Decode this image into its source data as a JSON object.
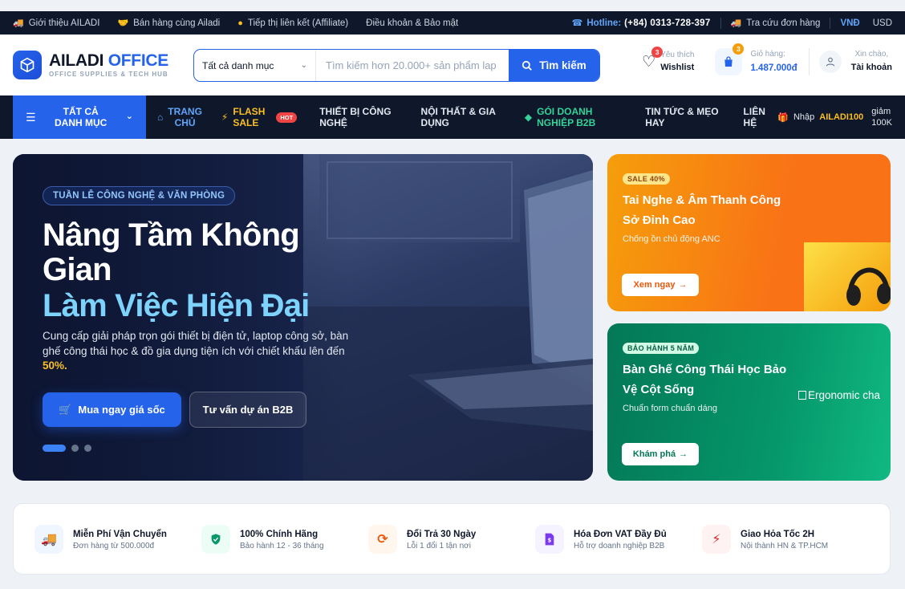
{
  "utility": {
    "links": [
      {
        "icon": "truck-icon",
        "label": "Giới thiệu AILADI",
        "color": "#60a5fa"
      },
      {
        "icon": "handshake-icon",
        "label": "Bán hàng cùng Ailadi",
        "color": "#34d399"
      },
      {
        "icon": "coins-icon",
        "label": "Tiếp thị liên kết (Affiliate)",
        "color": "#fbbf24"
      },
      {
        "icon": "",
        "label": "Điều khoản & Bảo mật",
        "color": ""
      }
    ],
    "hotline_label": "Hotline:",
    "hotline_number": "(+84) 0313-728-397",
    "order_lookup": "Tra cứu đơn hàng",
    "currencies": [
      "VNĐ",
      "USD"
    ]
  },
  "header": {
    "logo_main_a": "AILADI",
    "logo_main_b": "OFFICE",
    "logo_sub": "OFFICE SUPPLIES & TECH HUB",
    "search": {
      "category": "Tất cả danh mục",
      "placeholder": "Tìm kiếm hơn 20.000+ sản phẩm lap",
      "button": "Tìm kiếm"
    },
    "wishlist": {
      "label_top": "Yêu thích",
      "label": "Wishlist",
      "count": "3"
    },
    "cart": {
      "label_top": "Giỏ hàng:",
      "total": "1.487.000đ",
      "count": "3"
    },
    "account": {
      "greeting": "Xin chào,",
      "label": "Tài khoản"
    }
  },
  "nav": {
    "all_categories": "TẤT CẢ\nDANH MỤC",
    "items": [
      {
        "label": "TRANG\nCHỦ",
        "style": "blue",
        "icon": "home-icon"
      },
      {
        "label": "FLASH\nSALE",
        "style": "yellow",
        "icon": "bolt-icon",
        "badge": "HOT"
      },
      {
        "label": "THIẾT BỊ CÔNG\nNGHỆ",
        "style": "white",
        "icon": ""
      },
      {
        "label": "NỘI THẤT & GIA\nDỤNG",
        "style": "white",
        "icon": ""
      },
      {
        "label": "GÓI DOANH\nNGHIỆP B2B",
        "style": "green",
        "icon": "tag-icon"
      },
      {
        "label": "TIN TỨC & MẸO\nHAY",
        "style": "white",
        "icon": ""
      },
      {
        "label": "LIÊN\nHỆ",
        "style": "white",
        "icon": ""
      }
    ],
    "promo_prefix": "Nhập",
    "promo_code": "AILADI100",
    "promo_suffix": "giảm\n100K"
  },
  "hero": {
    "pill": "TUẦN LỄ CÔNG NGHỆ & VĂN PHÒNG",
    "title_line1": "Nâng Tầm Không Gian",
    "title_line2": "Làm Việc Hiện Đại",
    "description": "Cung cấp giải pháp trọn gói thiết bị điện tử, laptop công sở, bàn ghế công thái học & đồ gia dụng tiện ích với chiết khấu lên đến",
    "description_highlight": "50%.",
    "cta_primary": "Mua ngay giá sốc",
    "cta_secondary": "Tư vấn dự án B2B",
    "slides_total": 3,
    "slide_active": 1
  },
  "side_banners": [
    {
      "tag": "SALE 40%",
      "title": "Tai Nghe & Âm Thanh Công Sở Đỉnh Cao",
      "subtitle": "Chống ồn chủ động ANC",
      "button": "Xem ngay"
    },
    {
      "tag": "BẢO HÀNH 5 NĂM",
      "title": "Bàn Ghế Công Thái Học Bảo Vệ Cột Sống",
      "subtitle": "Chuẩn form chuẩn dáng",
      "button": "Khám phá",
      "image_alt": "Ergonomic cha"
    }
  ],
  "features": [
    {
      "icon": "truck-icon",
      "title": "Miễn Phí Vận Chuyển",
      "subtitle": "Đơn hàng từ 500.000đ",
      "color": "#2563eb",
      "bg": "#eff6ff"
    },
    {
      "icon": "shield-icon",
      "title": "100% Chính Hãng",
      "subtitle": "Bảo hành 12 - 36 tháng",
      "color": "#059669",
      "bg": "#ecfdf5"
    },
    {
      "icon": "refresh-icon",
      "title": "Đổi Trả 30 Ngày",
      "subtitle": "Lỗi 1 đổi 1 tận nơi",
      "color": "#ea580c",
      "bg": "#fff7ed"
    },
    {
      "icon": "invoice-icon",
      "title": "Hóa Đơn VAT Đầy Đủ",
      "subtitle": "Hỗ trợ doanh nghiệp B2B",
      "color": "#7c3aed",
      "bg": "#f5f3ff"
    },
    {
      "icon": "bolt-icon",
      "title": "Giao Hỏa Tốc 2H",
      "subtitle": "Nội thành HN & TP.HCM",
      "color": "#dc2626",
      "bg": "#fef2f2"
    }
  ]
}
